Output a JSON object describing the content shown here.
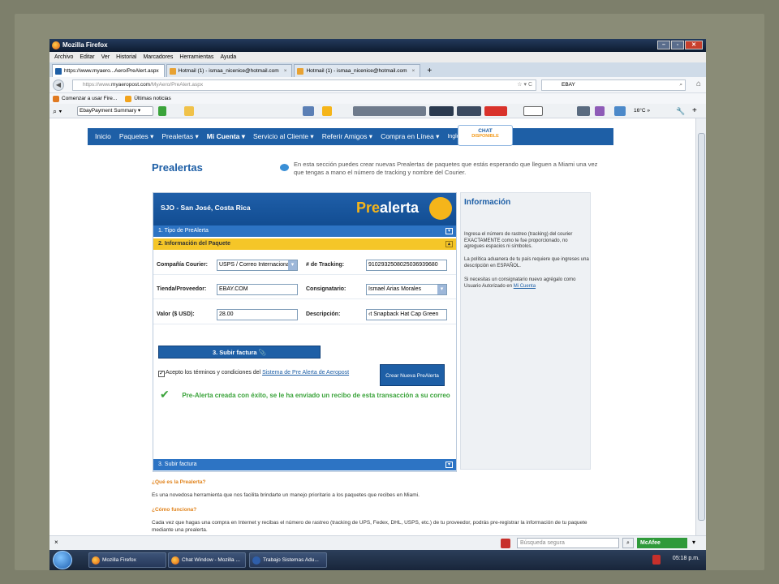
{
  "window": {
    "title": "Mozilla Firefox"
  },
  "menu": [
    "Archivo",
    "Editar",
    "Ver",
    "Historial",
    "Marcadores",
    "Herramientas",
    "Ayuda"
  ],
  "tabs": [
    {
      "label": "https://www.myaero...Aero/PreAlert.aspx"
    },
    {
      "label": "Hotmail (1) - ismaa_nicenice@hotmail.com"
    },
    {
      "label": "Hotmail (1) - ismaa_nicenice@hotmail.com"
    }
  ],
  "nav": {
    "url_prefix": "https://www.",
    "url_domain": "myaeropost.com",
    "url_path": "/MyAero/PreAlert.aspx",
    "search_value": "EBAY"
  },
  "bookmarks": [
    "Comenzar a usar Fire...",
    "Últimas noticias"
  ],
  "toolbar2": {
    "dropdown": "EbayPayment Summary",
    "weather": "16°C"
  },
  "site_nav": {
    "items": [
      "Inicio",
      "Paquetes ▾",
      "Prealertas ▾",
      "Mi Cuenta ▾",
      "Servicio al Cliente ▾",
      "Referir Amigos ▾",
      "Compra en Línea ▾",
      "Inglés"
    ],
    "chat_label": "CHAT",
    "chat_sub": "DISPONIBLE"
  },
  "page": {
    "title": "Prealertas",
    "intro": "En esta sección puedes crear nuevas Prealertas de paquetes que estás esperando que lleguen a Miami una vez que tengas a mano el número de tracking y nombre del Courier."
  },
  "form": {
    "location": "SJO - San José, Costa Rica",
    "brand_pre": "Pre",
    "brand_alerta": "alerta",
    "sec1": "1. Tipo de PreAlerta",
    "sec2": "2. Información del Paquete",
    "courier_label": "Compañía Courier:",
    "courier_value": "USPS / Correo Internacional",
    "tracking_label": "# de Tracking:",
    "tracking_value": "9102932508025036939680",
    "store_label": "Tienda/Proveedor:",
    "store_value": "EBAY.COM",
    "consignee_label": "Consignatario:",
    "consignee_value": "Ismael Arias Morales",
    "value_label": "Valor ($ USD):",
    "value_value": "28.00",
    "desc_label": "Descripción:",
    "desc_value": "‹t Snapback Hat Cap Green",
    "upload_button": "3. Subir factura",
    "terms_text": "Acepto los términos y condiciones del ",
    "terms_link": "Sistema de Pre Alerta de Aeropost",
    "create_button": "Crear Nueva PreAlerta",
    "success": "Pre-Alerta creada con éxito, se le ha enviado un recibo de esta transacción a su correo",
    "sec3": "3. Subir factura"
  },
  "info": {
    "title": "Información",
    "p1": "Ingresa el número de rastreo (tracking) del courier EXACTAMENTE como te fue proporcionado, no agregues espacios ni símbolos.",
    "p2": "La política aduanera de tu país requiere que ingreses una descripción en ESPAÑOL.",
    "p3": "Si necesitas un consignatario nuevo agrégalo como Usuario Autorizado en ",
    "p3_link": "Mi Cuenta"
  },
  "faq": {
    "q1": "¿Qué es la Prealerta?",
    "a1": "Es una novedosa herramienta que nos facilita brindarte un manejo prioritario a los paquetes que recibes en Miami.",
    "q2": "¿Cómo funciona?",
    "a2": "Cada vez que hagas una compra en Internet y recibas el número de rastreo (tracking de UPS, Fedex, DHL, USPS, etc.) de tu proveedor, podrás pre-registrar la información de tu paquete mediante una prealerta."
  },
  "statusbar": {
    "search_placeholder": "Búsqueda segura",
    "mcafee": "McAfee"
  },
  "taskbar": {
    "items": [
      "Mozilla Firefox",
      "Chat Window - Mozilla ...",
      "Trabajo Sistemas Adu..."
    ],
    "clock": "05:18 p.m."
  }
}
